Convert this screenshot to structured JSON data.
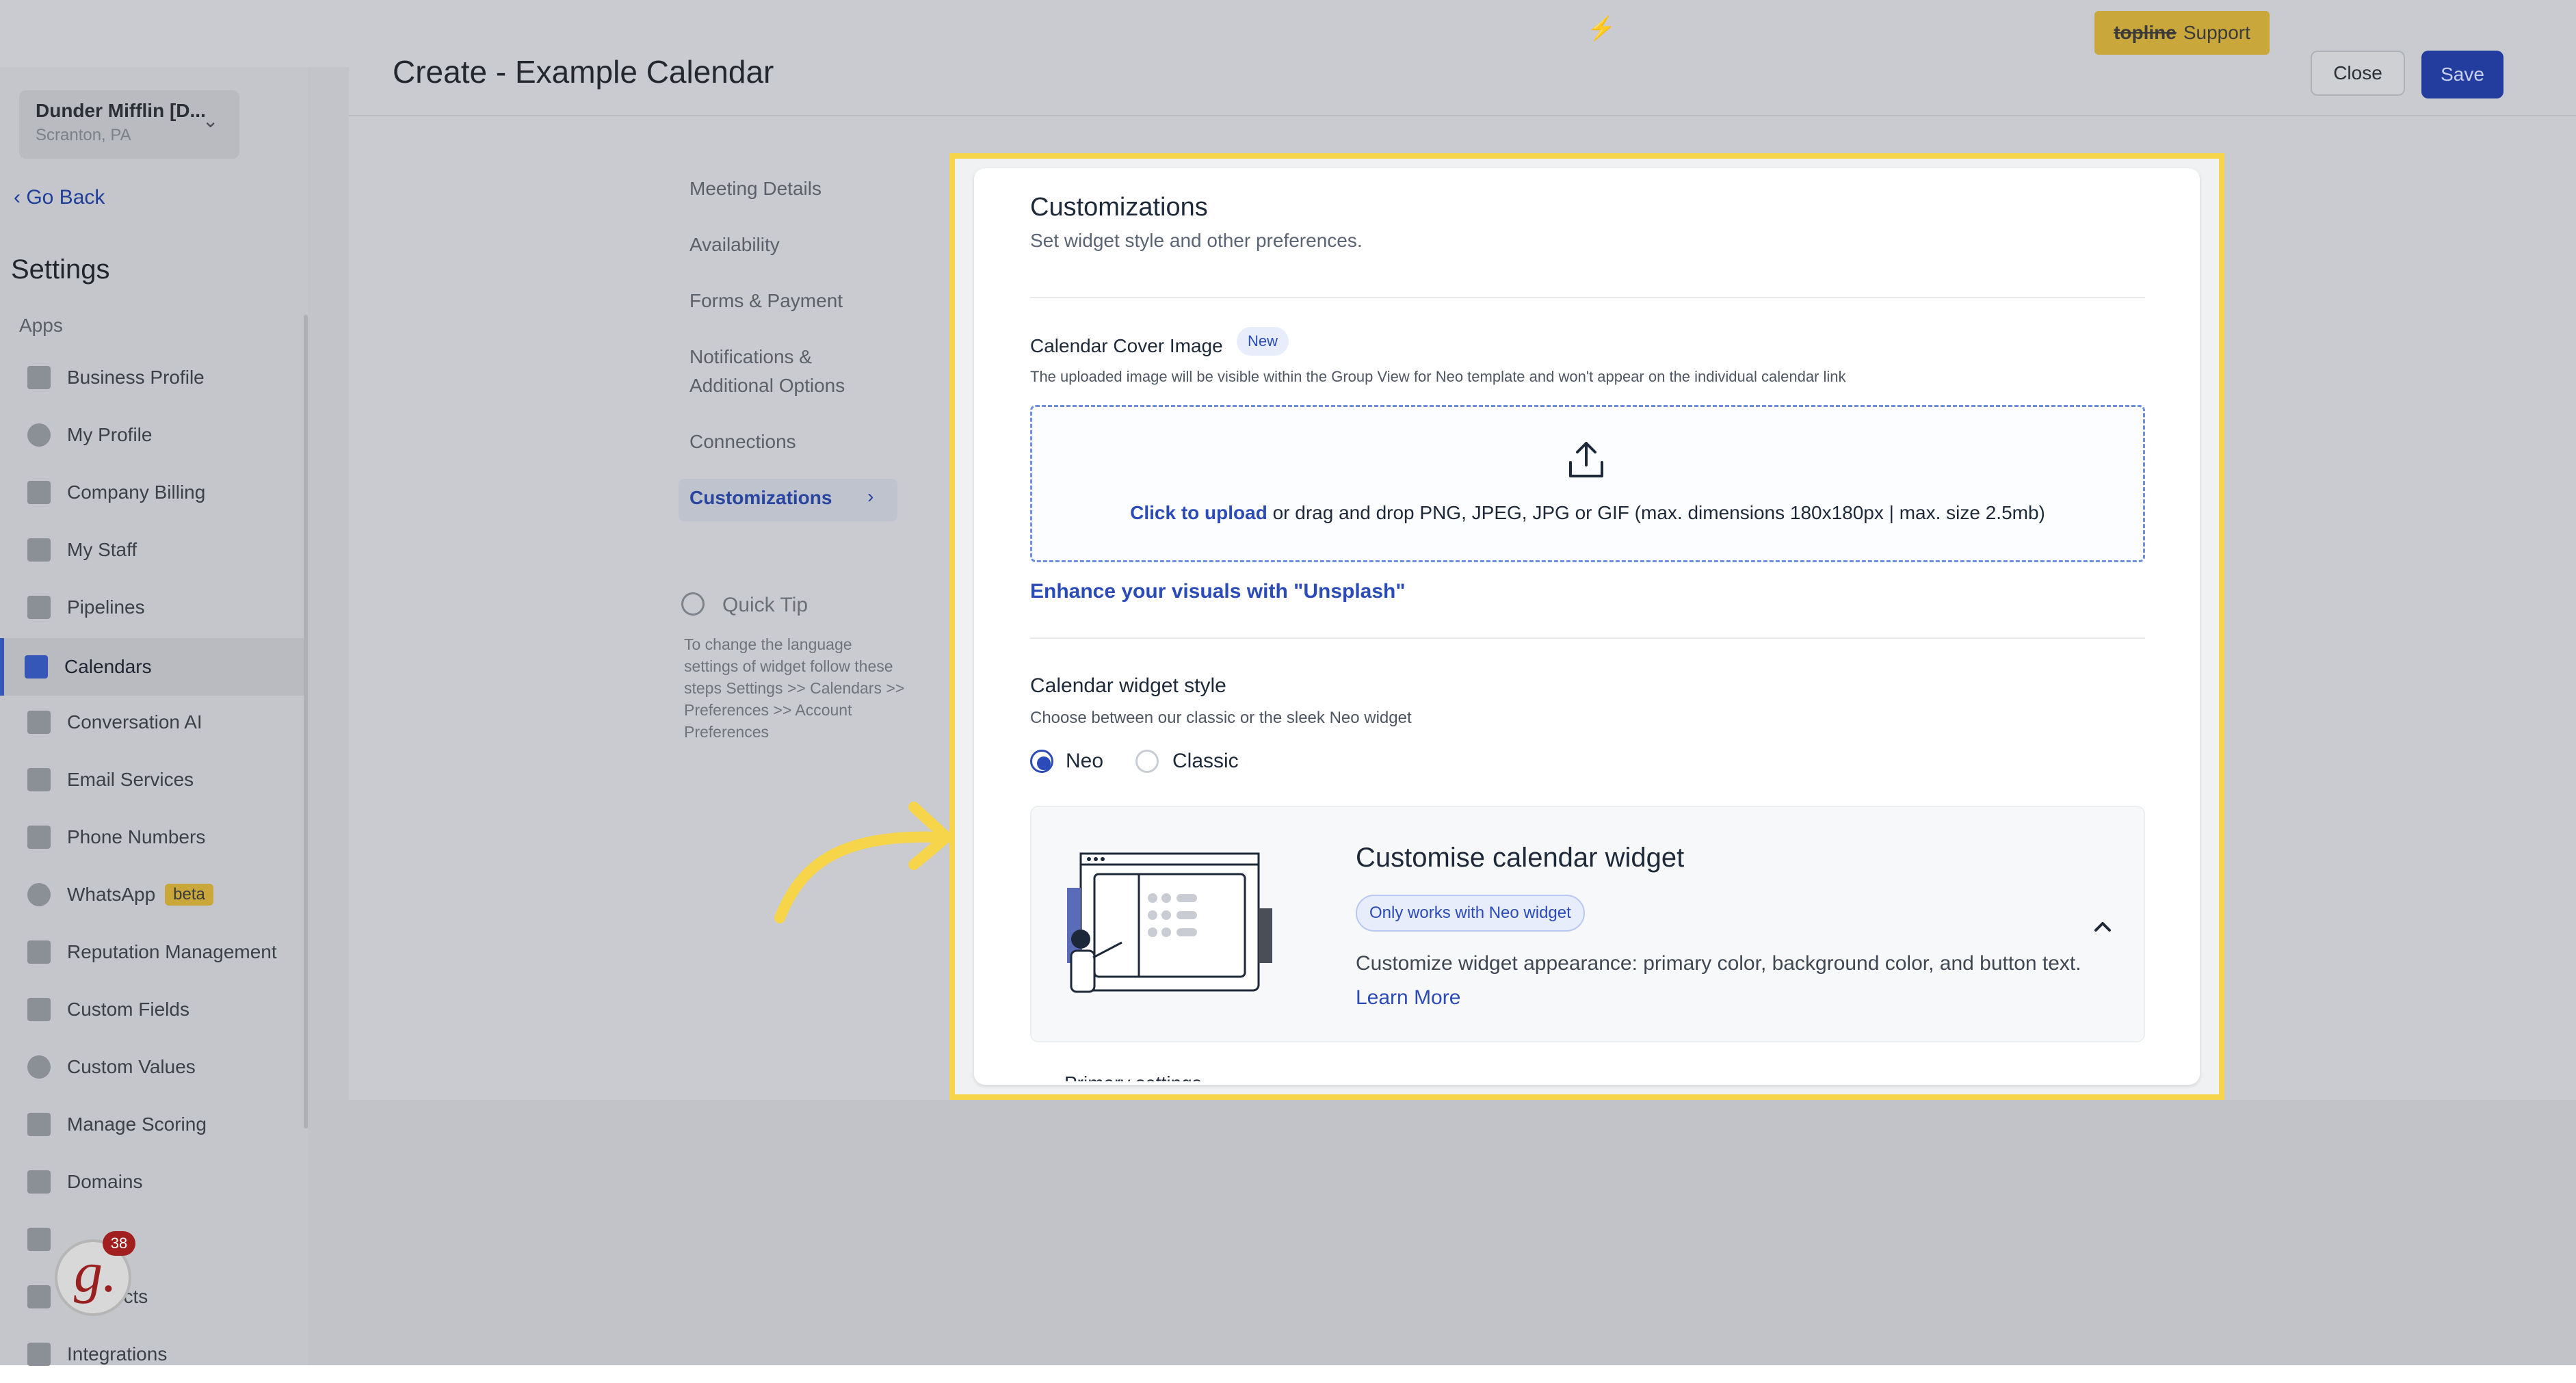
{
  "topbar": {
    "bolt_icon": "lightning-icon",
    "support_brand": "topline",
    "support_label": "Support"
  },
  "sidebar": {
    "location_name": "Dunder Mifflin [D...",
    "location_city": "Scranton, PA",
    "go_back": "Go Back",
    "title": "Settings",
    "section": "Apps",
    "items": [
      {
        "label": "Business Profile",
        "icon": "briefcase-icon"
      },
      {
        "label": "My Profile",
        "icon": "person-icon"
      },
      {
        "label": "Company Billing",
        "icon": "grid-icon"
      },
      {
        "label": "My Staff",
        "icon": "staff-icon"
      },
      {
        "label": "Pipelines",
        "icon": "filter-icon"
      },
      {
        "label": "Calendars",
        "icon": "calendar-icon"
      },
      {
        "label": "Conversation AI",
        "icon": "chat-icon"
      },
      {
        "label": "Email Services",
        "icon": "email-icon"
      },
      {
        "label": "Phone Numbers",
        "icon": "phone-icon"
      },
      {
        "label": "WhatsApp",
        "icon": "whatsapp-icon"
      },
      {
        "label": "Reputation Management",
        "icon": "star-icon"
      },
      {
        "label": "Custom Fields",
        "icon": "edit-icon"
      },
      {
        "label": "Custom Values",
        "icon": "pie-icon"
      },
      {
        "label": "Manage Scoring",
        "icon": "chart-icon"
      },
      {
        "label": "Domains",
        "icon": "domain-icon"
      },
      {
        "label": "",
        "icon": "video-icon"
      },
      {
        "label": "Redirects",
        "icon": "link-icon"
      },
      {
        "label": "Integrations",
        "icon": "integrations-icon"
      }
    ],
    "whatsapp_badge": "beta",
    "grader_letter": "g.",
    "grader_count": "38"
  },
  "header": {
    "title": "Create - Example Calendar",
    "close_label": "Close",
    "save_label": "Save"
  },
  "subnav": {
    "items": [
      "Meeting Details",
      "Availability",
      "Forms & Payment",
      "Notifications &",
      "Additional Options",
      "Connections"
    ],
    "active": "Customizations",
    "tip_title": "Quick Tip",
    "tip_text": "To change the language settings of widget follow these steps Settings >> Calendars >> Preferences >> Account Preferences"
  },
  "customizations": {
    "title": "Customizations",
    "subtitle": "Set widget style and other preferences.",
    "cover_label": "Calendar Cover Image",
    "new_badge": "New",
    "cover_help": "The uploaded image will be visible within the Group View for Neo template and won't appear on the individual calendar link",
    "upload_link": "Click to upload",
    "upload_rest": " or drag and drop PNG, JPEG, JPG or GIF (max. dimensions 180x180px | max. size 2.5mb)",
    "unsplash": "Enhance your visuals with \"Unsplash\"",
    "style_label": "Calendar widget style",
    "style_help": "Choose between our classic or the sleek Neo widget",
    "neo_label": "Neo",
    "classic_label": "Classic",
    "widget_title": "Customise calendar widget",
    "neo_only": "Only works with Neo widget",
    "widget_desc": "Customize widget appearance: primary color, background color, and button text.",
    "learn_more": "Learn More",
    "partial_next": "Primary settings"
  },
  "colors": {
    "accent": "#2b4bb8",
    "highlight": "#f7d54a",
    "support_button": "#c9a73b"
  }
}
